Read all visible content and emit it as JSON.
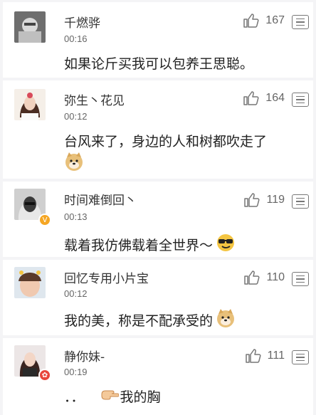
{
  "comments": [
    {
      "name": "千燃骅",
      "time": "00:16",
      "text": "如果论斤买我可以包养王思聪。",
      "likes": "167"
    },
    {
      "name": "弥生丶花见",
      "time": "00:12",
      "text": "台风来了，身边的人和树都吹走了",
      "likes": "164",
      "emoji": "doge-emoji"
    },
    {
      "name": "时间难倒回丶",
      "time": "00:13",
      "text": "载着我仿佛载着全世界～",
      "likes": "119",
      "emoji": "sunglasses-emoji",
      "badge": "V"
    },
    {
      "name": "回忆专用小片宝",
      "time": "00:12",
      "text": "我的美，称是不配承受的",
      "likes": "110",
      "emoji": "doge-emoji"
    },
    {
      "name": "静你妹-",
      "time": "00:19",
      "text": "我的胸",
      "text_prefix": "．．",
      "likes": "111",
      "emoji": "pointing-hand-emoji",
      "badge": "✿"
    }
  ],
  "icons": {
    "like": "thumbs-up-icon",
    "more": "more-menu-icon"
  },
  "colors": {
    "badge_v": "#f5a623",
    "badge_member": "#e8463c",
    "divider": "#e5e5e5"
  }
}
